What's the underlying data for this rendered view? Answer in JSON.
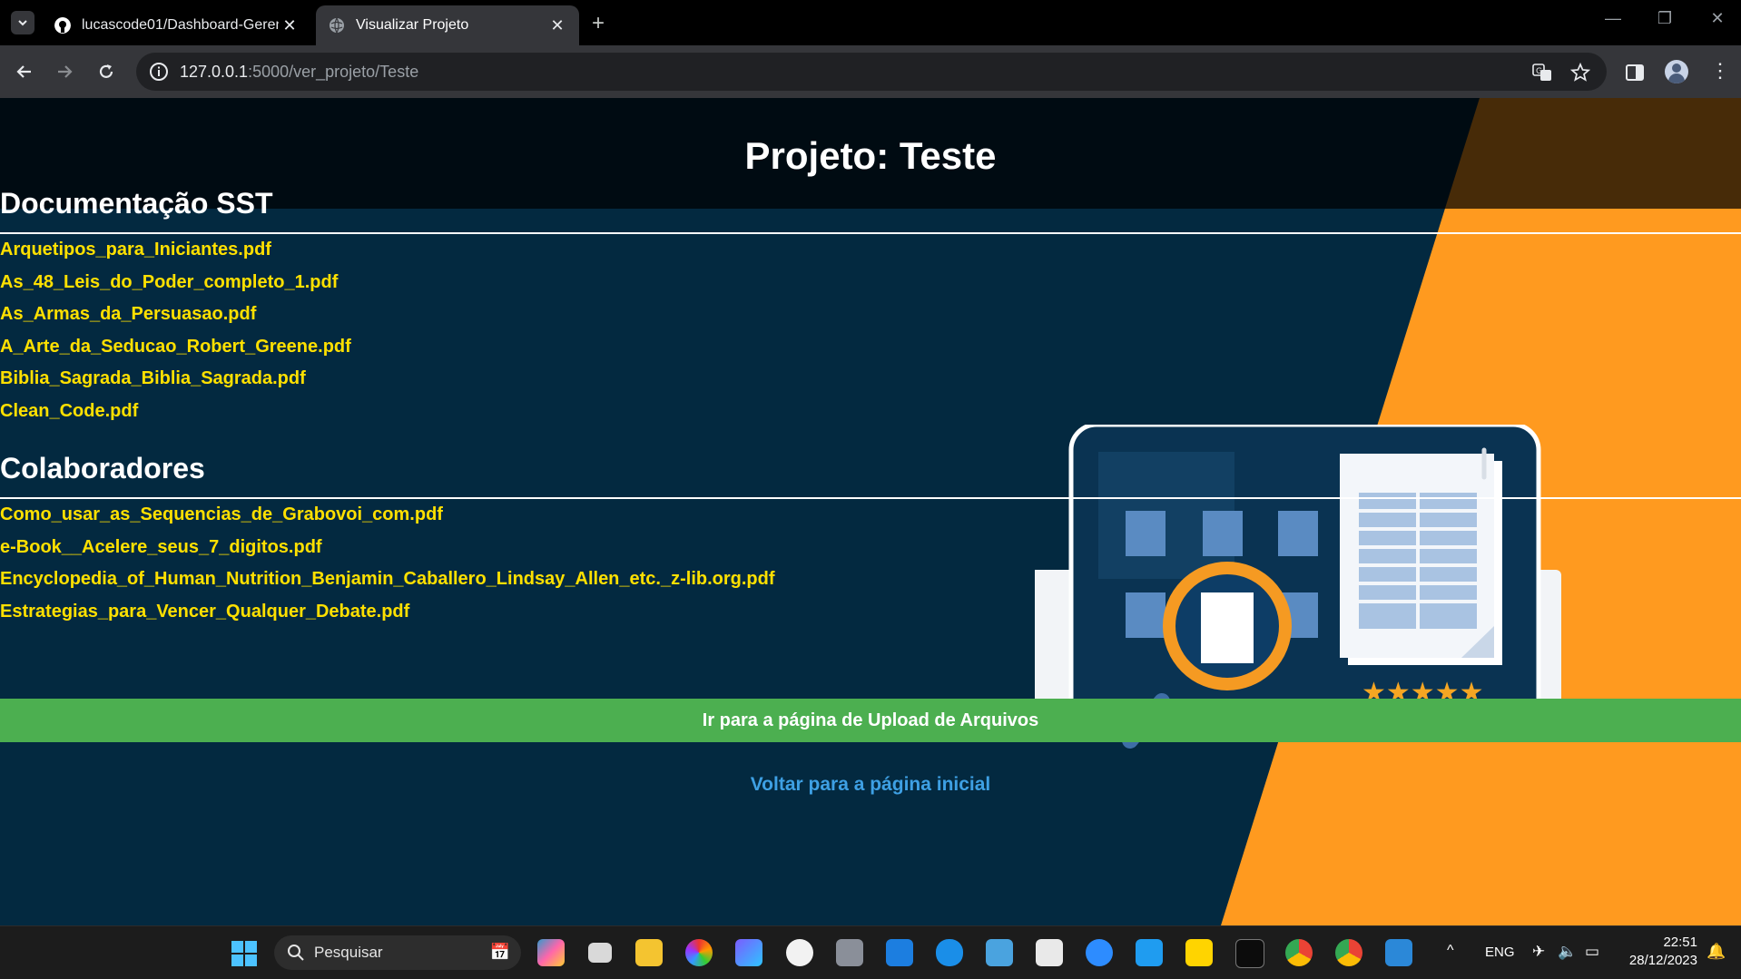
{
  "browser": {
    "tabs": [
      {
        "title": "lucascode01/Dashboard-Gerenc",
        "active": false,
        "icon": "github-icon"
      },
      {
        "title": "Visualizar Projeto",
        "active": true,
        "icon": "globe-icon"
      }
    ],
    "url_host": "127.0.0.1",
    "url_path": ":5000/ver_projeto/Teste"
  },
  "page": {
    "title": "Projeto: Teste",
    "sections": [
      {
        "title": "Documentação SST",
        "files": [
          "Arquetipos_para_Iniciantes.pdf",
          "As_48_Leis_do_Poder_completo_1.pdf",
          "As_Armas_da_Persuasao.pdf",
          "A_Arte_da_Seducao_Robert_Greene.pdf",
          "Biblia_Sagrada_Biblia_Sagrada.pdf",
          "Clean_Code.pdf"
        ]
      },
      {
        "title": "Colaboradores",
        "files": [
          "Como_usar_as_Sequencias_de_Grabovoi_com.pdf",
          "e-Book__Acelere_seus_7_digitos.pdf",
          "Encyclopedia_of_Human_Nutrition_Benjamin_Caballero_Lindsay_Allen_etc._z-lib.org.pdf",
          "Estrategias_para_Vencer_Qualquer_Debate.pdf"
        ]
      }
    ],
    "upload_button": "Ir para a página de Upload de Arquivos",
    "home_link": "Voltar para a página inicial",
    "colors": {
      "background": "#032940",
      "accent": "#ff9a1f",
      "link": "#ffe000",
      "button": "#4caf50"
    }
  },
  "taskbar": {
    "search_placeholder": "Pesquisar",
    "language": "ENG",
    "time": "22:51",
    "date": "28/12/2023"
  }
}
